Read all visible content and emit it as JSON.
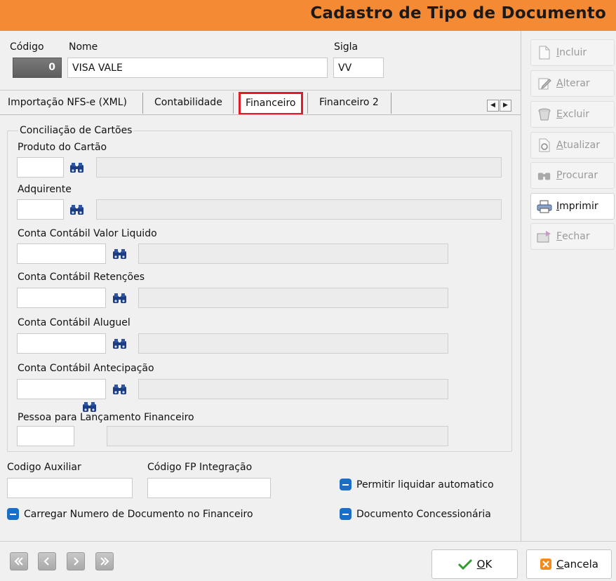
{
  "window": {
    "title": "Cadastro de Tipo de Documento"
  },
  "header": {
    "codigo_label": "Código",
    "codigo_value": "0",
    "nome_label": "Nome",
    "nome_value": "VISA VALE",
    "sigla_label": "Sigla",
    "sigla_value": "VV"
  },
  "tabs": [
    {
      "label": "Importação NFS-e (XML)"
    },
    {
      "label": "Contabilidade"
    },
    {
      "label": "Financeiro",
      "active": true
    },
    {
      "label": "Financeiro 2"
    }
  ],
  "tab_scroll": {
    "left": "◀",
    "right": "▶"
  },
  "conciliacao": {
    "group_label": "Conciliação de Cartões",
    "produto_label": "Produto do Cartão",
    "adquirente_label": "Adquirente",
    "cc_valor_liquido_label": "Conta Contábil Valor Liquido",
    "cc_retencoes_label": "Conta Contábil Retenções",
    "cc_aluguel_label": "Conta Contábil Aluguel",
    "cc_antecipacao_label": "Conta Contábil Antecipação",
    "pessoa_label": "Pessoa para Lançamento Financeiro"
  },
  "extras": {
    "codigo_auxiliar_label": "Codigo Auxiliar",
    "codigo_fp_label": "Código FP Integração",
    "permitir_liquidar_label": "Permitir liquidar automatico",
    "carregar_numero_label": "Carregar Numero de Documento no Financeiro",
    "documento_concessionaria_label": "Documento Concessionária"
  },
  "sidebar": {
    "incluir": {
      "first": "I",
      "rest": "ncluir"
    },
    "alterar": {
      "first": "A",
      "rest": "lterar"
    },
    "excluir": {
      "first": "E",
      "rest": "xcluir"
    },
    "atualizar": {
      "first": "A",
      "rest": "tualizar"
    },
    "procurar": {
      "first": "P",
      "rest": "rocurar"
    },
    "imprimir": {
      "first": "I",
      "rest": "mprimir"
    },
    "fechar": {
      "first": "F",
      "rest": "echar"
    }
  },
  "footer": {
    "ok": {
      "first": "O",
      "rest": "K"
    },
    "cancela": {
      "first": "C",
      "rest": "ancela"
    }
  },
  "colors": {
    "title_bar": "#f58a34",
    "active_tab_border": "#e01c24",
    "checkbox": "#1a6ec8"
  }
}
